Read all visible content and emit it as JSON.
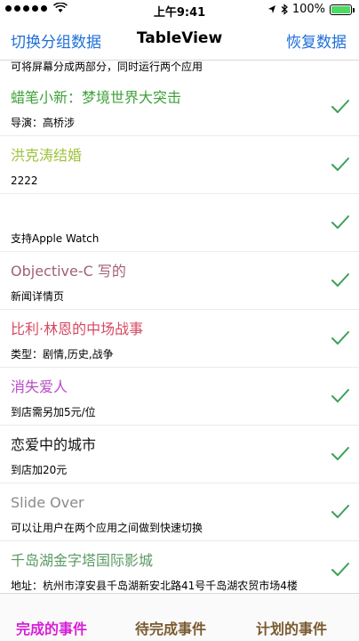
{
  "status_bar": {
    "time": "上午9:41",
    "battery_text": "100%"
  },
  "nav": {
    "left_button": "切换分组数据",
    "title": "TableView",
    "right_button": "恢复数据"
  },
  "table": {
    "partial_top_text": "可将屏幕分成两部分，同时运行两个应用",
    "rows": [
      {
        "title": "蜡笔小新：梦境世界大突击",
        "subtitle": "导演：高桥涉",
        "color": "#3fa13a"
      },
      {
        "title": "洪克涛结婚",
        "subtitle": "2222",
        "color": "#9ec23a"
      },
      {
        "title": "",
        "subtitle": "支持Apple Watch",
        "color": "#000000"
      },
      {
        "title": "Objective-C 写的",
        "subtitle": "新闻详情页",
        "color": "#a0607a"
      },
      {
        "title": "比利·林恩的中场战事",
        "subtitle": "类型：剧情,历史,战争",
        "color": "#d64a62"
      },
      {
        "title": "消失爱人",
        "subtitle": "到店需另加5元/位",
        "color": "#b94bc7"
      },
      {
        "title": "恋爱中的城市",
        "subtitle": "到店加20元",
        "color": "#111111"
      },
      {
        "title": "Slide Over",
        "subtitle": "可以让用户在两个应用之间做到快速切换",
        "color": "#8a8a8a"
      },
      {
        "title": "千岛湖金字塔国际影城",
        "subtitle": "地址：杭州市淳安县千岛湖新安北路41号千岛湖农贸市场4楼",
        "color": "#5a9a63"
      }
    ],
    "checkmark_color": "#3aa15a"
  },
  "tab_bar": {
    "tabs": [
      "完成的事件",
      "待完成事件",
      "计划的事件"
    ]
  }
}
